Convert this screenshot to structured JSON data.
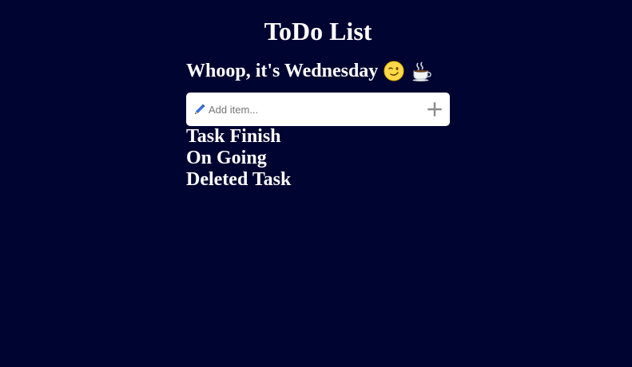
{
  "app": {
    "title": "ToDo List",
    "greeting": "Whoop, it's Wednesday",
    "greeting_icons": [
      "wink-face-icon",
      "hot-coffee-icon"
    ]
  },
  "add_item": {
    "placeholder": "Add item...",
    "value": "",
    "icon": "pen-icon",
    "button_icon": "plus-icon"
  },
  "sections": [
    {
      "label": "Task Finish"
    },
    {
      "label": "On Going"
    },
    {
      "label": "Deleted Task"
    }
  ],
  "colors": {
    "background": "#000430",
    "text": "#ffffff",
    "input_background": "#ffffff",
    "plus": "#8a8a8a"
  }
}
